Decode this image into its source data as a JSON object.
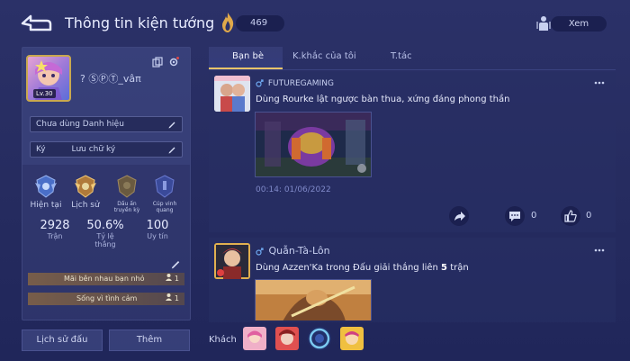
{
  "header": {
    "title": "Thông tin kiện tướng",
    "coins": "469",
    "view_label": "Xem"
  },
  "profile": {
    "level": "Lv.30",
    "name": "? ⓈⓅⓉ_vâπ",
    "title_field": "Chưa dùng Danh hiệu",
    "signature_prefix": "Ký",
    "signature_placeholder": "Lưu chữ ký"
  },
  "ranks": [
    {
      "label": "Hiện tại"
    },
    {
      "label": "Lịch sử"
    },
    {
      "label": "Dấu ấn truyền kỳ"
    },
    {
      "label": "Cúp vinh quang"
    }
  ],
  "stats": [
    {
      "value": "2928",
      "label": "Trận"
    },
    {
      "value": "50.6%",
      "label": "Tỷ lệ thắng"
    },
    {
      "value": "100",
      "label": "Uy tín"
    }
  ],
  "tags": [
    {
      "text": "Mãi bên nhau bạn nhỏ",
      "count": "1"
    },
    {
      "text": "Sống vì tình cảm",
      "count": "1"
    }
  ],
  "bottom_buttons": {
    "history": "Lịch sử đấu",
    "add": "Thêm"
  },
  "tabs": [
    "Bạn bè",
    "K.khắc của tôi",
    "T.tác"
  ],
  "posts": [
    {
      "author": "FUTUREGAMING",
      "text": "Dùng Rourke lật ngược bàn thua, xứng đáng phong thần",
      "time": "00:14: 01/06/2022",
      "comments": "0",
      "likes": "0"
    },
    {
      "author": "Quẫn-Tà-Lôn",
      "text_before": "Dùng Azzen'Ka trong Đấu giải thắng liên ",
      "text_num": "5",
      "text_after": " trận"
    }
  ],
  "guest_label": "Khách",
  "colors": {
    "background": "#262c60",
    "accent_gold": "#e9c46a",
    "panel": "#383f78",
    "time_text": "#7f89c8"
  },
  "icons": {
    "back": "back-arrow-icon",
    "coin": "flame-coin-icon",
    "view": "view-person-icon",
    "share": "share-icon",
    "comment": "comment-icon",
    "like": "thumbs-up-icon",
    "more": "more-dots-icon",
    "edit": "pencil-icon"
  }
}
